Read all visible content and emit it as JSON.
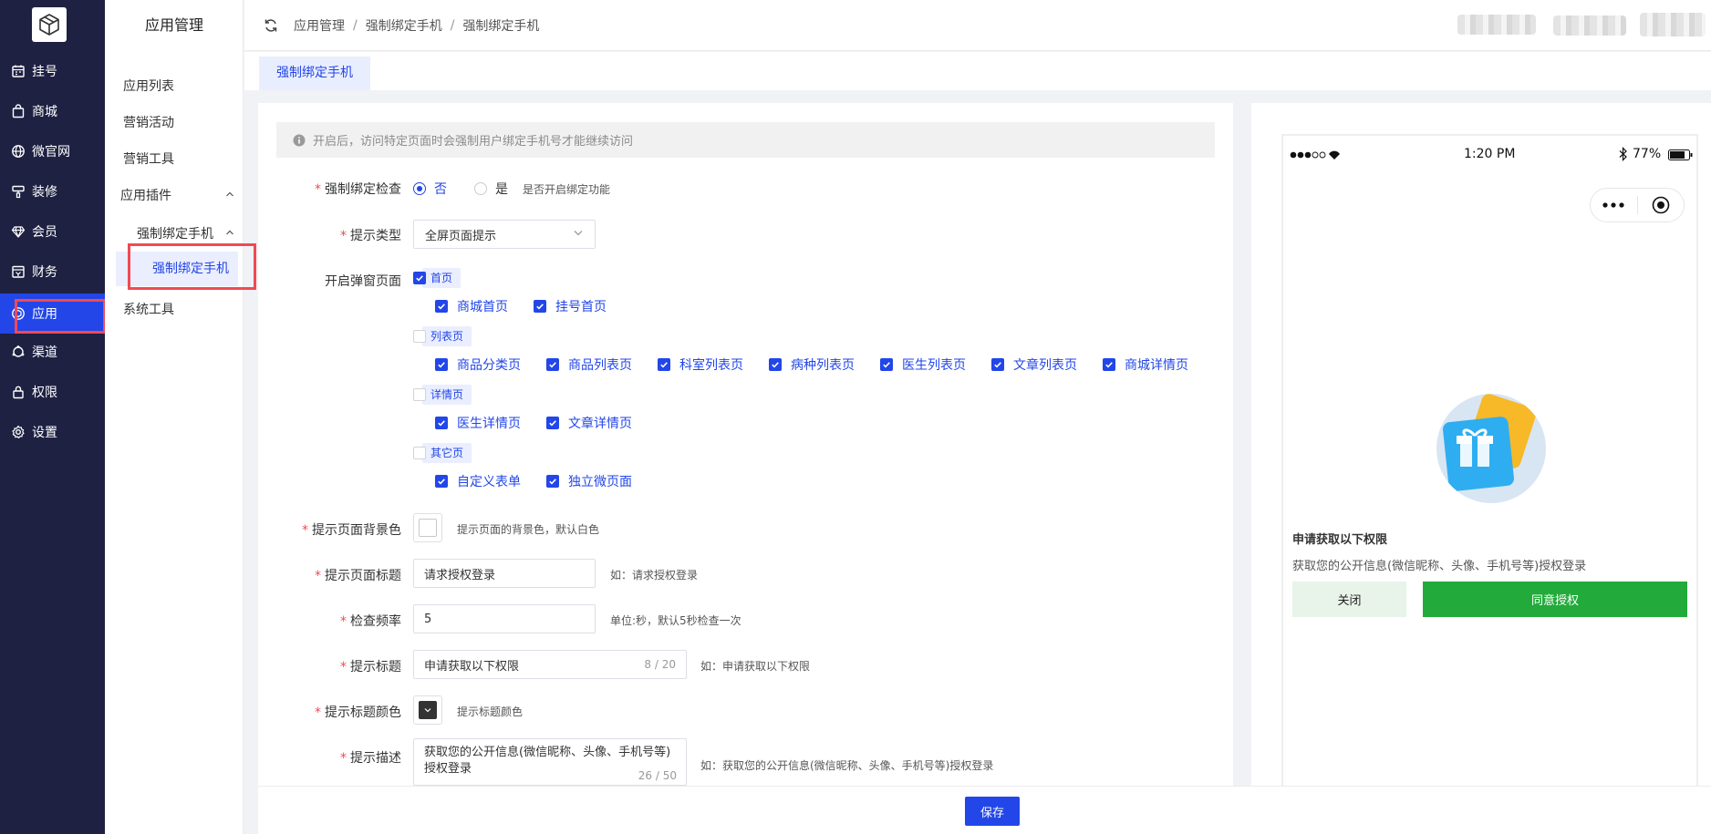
{
  "nav": {
    "items": [
      {
        "label": "挂号",
        "icon": "calendar-icon"
      },
      {
        "label": "商城",
        "icon": "shopping-bag-icon"
      },
      {
        "label": "微官网",
        "icon": "globe-icon"
      },
      {
        "label": "装修",
        "icon": "brush-icon"
      },
      {
        "label": "会员",
        "icon": "diamond-icon"
      },
      {
        "label": "财务",
        "icon": "finance-icon"
      },
      {
        "label": "应用",
        "icon": "app-icon",
        "active": true
      },
      {
        "label": "渠道",
        "icon": "channel-icon"
      },
      {
        "label": "权限",
        "icon": "lock-icon"
      },
      {
        "label": "设置",
        "icon": "gear-icon"
      }
    ]
  },
  "sidebar": {
    "title": "应用管理",
    "items": [
      "应用列表",
      "营销活动",
      "营销工具"
    ],
    "group": "应用插件",
    "sub_group": "强制绑定手机",
    "active_leaf": "强制绑定手机",
    "last_item": "系统工具"
  },
  "breadcrumb": [
    "应用管理",
    "强制绑定手机",
    "强制绑定手机"
  ],
  "tabs": [
    "强制绑定手机"
  ],
  "form": {
    "alert": "开启后，访问特定页面时会强制用户绑定手机号才能继续访问",
    "force_check": {
      "label": "强制绑定检查",
      "option_no": "否",
      "option_yes": "是",
      "hint": "是否开启绑定功能",
      "selected": "否"
    },
    "tip_type": {
      "label": "提示类型",
      "value": "全屏页面提示"
    },
    "popup_pages": {
      "label": "开启弹窗页面",
      "groups": [
        {
          "tag": "首页",
          "checked": true,
          "items": [
            "商城首页",
            "挂号首页"
          ]
        },
        {
          "tag": "列表页",
          "checked": false,
          "items": [
            "商品分类页",
            "商品列表页",
            "科室列表页",
            "病种列表页",
            "医生列表页",
            "文章列表页",
            "商城详情页"
          ]
        },
        {
          "tag": "详情页",
          "checked": false,
          "items": [
            "医生详情页",
            "文章详情页"
          ]
        },
        {
          "tag": "其它页",
          "checked": false,
          "items": [
            "自定义表单",
            "独立微页面"
          ]
        }
      ]
    },
    "bg_color": {
      "label": "提示页面背景色",
      "hint": "提示页面的背景色，默认白色",
      "value": "#ffffff"
    },
    "page_title": {
      "label": "提示页面标题",
      "value": "请求授权登录",
      "hint": "如：请求授权登录"
    },
    "check_freq": {
      "label": "检查频率",
      "value": "5",
      "hint": "单位:秒，默认5秒检查一次"
    },
    "tip_title": {
      "label": "提示标题",
      "value": "申请获取以下权限",
      "count": "8 / 20",
      "hint": "如：申请获取以下权限"
    },
    "title_color": {
      "label": "提示标题颜色",
      "hint": "提示标题颜色",
      "value": "#333333"
    },
    "tip_desc": {
      "label": "提示描述",
      "value": "获取您的公开信息(微信昵称、头像、手机号等)授权登录",
      "count": "26 / 50",
      "hint": "如：获取您的公开信息(微信昵称、头像、手机号等)授权登录"
    },
    "save_label": "保存"
  },
  "preview": {
    "time": "1:20 PM",
    "battery": "77%",
    "perm_title": "申请获取以下权限",
    "perm_desc": "获取您的公开信息(微信昵称、头像、手机号等)授权登录",
    "close_label": "关闭",
    "agree_label": "同意授权"
  },
  "colors": {
    "accent": "#2246e8",
    "nav_bg": "#1e2142",
    "agree": "#22ab3a",
    "required": "#f04a55"
  }
}
